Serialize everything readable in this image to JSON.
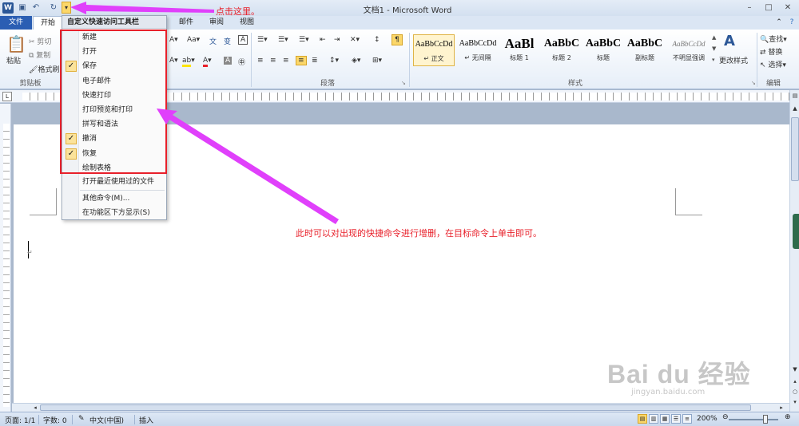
{
  "window": {
    "title": "文档1 - Microsoft Word",
    "app_letter": "W",
    "controls": [
      "–",
      "□",
      "✕"
    ]
  },
  "qat": {
    "buttons": [
      "save-icon",
      "undo-icon",
      "redo-icon"
    ],
    "dropdown_glyph": "▾"
  },
  "tabs": [
    "文件",
    "开始",
    "邮件",
    "审阅",
    "视图"
  ],
  "ribbon": {
    "clipboard": {
      "paste": "粘贴",
      "cut": "剪切",
      "copy": "复制",
      "format_painter": "格式刷",
      "label": "剪贴板"
    },
    "paragraph_label": "段落",
    "styles": {
      "label": "样式",
      "items": [
        {
          "sample": "AaBbCcDd",
          "name": "↵ 正文"
        },
        {
          "sample": "AaBbCcDd",
          "name": "↵ 无间隔"
        },
        {
          "sample": "AaBl",
          "name": "标题 1"
        },
        {
          "sample": "AaBbC",
          "name": "标题 2"
        },
        {
          "sample": "AaBbC",
          "name": "标题"
        },
        {
          "sample": "AaBbC",
          "name": "副标题"
        },
        {
          "sample": "AaBbCcDd",
          "name": "不明显强调"
        }
      ],
      "change_styles": "更改样式"
    },
    "editing": {
      "find": "查找",
      "replace": "替换",
      "select": "选择",
      "label": "编辑"
    }
  },
  "qat_menu": {
    "title": "自定义快速访问工具栏",
    "items": [
      {
        "label": "新建",
        "checked": false
      },
      {
        "label": "打开",
        "checked": false
      },
      {
        "label": "保存",
        "checked": true
      },
      {
        "label": "电子邮件",
        "checked": false
      },
      {
        "label": "快速打印",
        "checked": false
      },
      {
        "label": "打印预览和打印",
        "checked": false
      },
      {
        "label": "拼写和语法",
        "checked": false
      },
      {
        "label": "撤消",
        "checked": true
      },
      {
        "label": "恢复",
        "checked": true
      },
      {
        "label": "绘制表格",
        "checked": false
      },
      {
        "label": "打开最近使用过的文件",
        "checked": false
      }
    ],
    "more_commands": "其他命令(M)...",
    "show_below": "在功能区下方显示(S)"
  },
  "annotations": {
    "top": "点击这里。",
    "middle": "此时可以对出现的快捷命令进行增删，在目标命令上单击即可。"
  },
  "status": {
    "page": "页面: 1/1",
    "words": "字数: 0",
    "language": "中文(中国)",
    "mode": "插入",
    "zoom": "200%"
  },
  "watermark": {
    "big": "Bai du 经验",
    "small": "jingyan.baidu.com"
  },
  "colors": {
    "accent": "#2b5797",
    "annotation": "#e8202a",
    "arrow": "#e040fb",
    "check_bg": "#fbe39b"
  }
}
